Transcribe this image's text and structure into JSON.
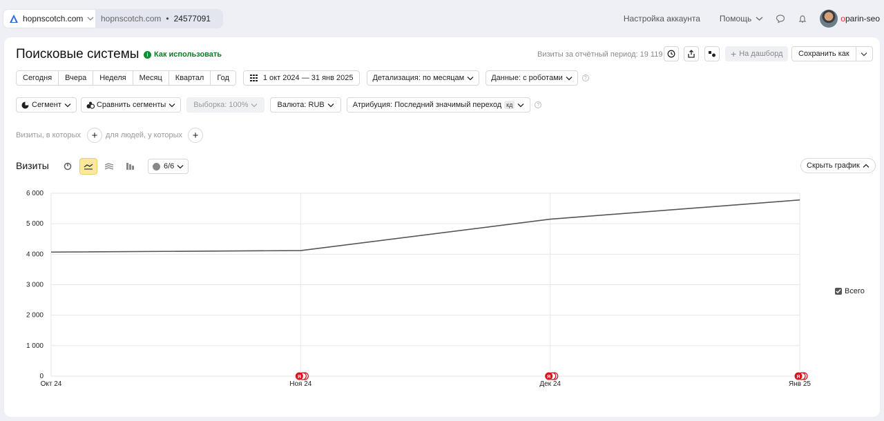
{
  "topbar": {
    "site_name": "hopnscotch.com",
    "counter_site": "hopnscotch.com",
    "counter_dot": "•",
    "counter_id": "24577091",
    "account_settings": "Настройка аккаунта",
    "help": "Помощь",
    "username_first": "o",
    "username_rest": "parin-seo"
  },
  "header": {
    "title": "Поисковые системы",
    "howto": "Как использовать",
    "visits_period": "Визиты за отчётный период: 19 119",
    "dashboard": "На дашборд",
    "save_as": "Сохранить как"
  },
  "periods": [
    "Сегодня",
    "Вчера",
    "Неделя",
    "Месяц",
    "Квартал",
    "Год"
  ],
  "date_range": "1 окт 2024 — 31 янв 2025",
  "detail": "Детализация: по месяцам",
  "data_mode": "Данные: с роботами",
  "segment": "Сегмент",
  "compare": "Сравнить сегменты",
  "sample": "Выборка: 100%",
  "currency": "Валюта: RUB",
  "attribution": "Атрибуция: Последний значимый переход",
  "attribution_badge": "кд",
  "filters": {
    "visits_label": "Визиты, в которых",
    "people_label": "для людей, у которых"
  },
  "section": {
    "title": "Визиты",
    "series_count": "6/6",
    "hide_chart": "Скрыть график"
  },
  "legend": {
    "total": "Всего"
  },
  "colors": {
    "line": "#555555",
    "event_marker": "#d9111c",
    "active_tool": "#fbe89a"
  },
  "chart_data": {
    "type": "line",
    "categories": [
      "Окт 24",
      "Ноя 24",
      "Дек 24",
      "Янв 25"
    ],
    "series": [
      {
        "name": "Всего",
        "values": [
          4070,
          4120,
          5150,
          5780
        ]
      }
    ],
    "ylim": [
      0,
      6000
    ],
    "yticks": [
      0,
      1000,
      2000,
      3000,
      4000,
      5000,
      6000
    ],
    "ytick_labels": [
      "0",
      "1 000",
      "2 000",
      "3 000",
      "4 000",
      "5 000",
      "6 000"
    ],
    "grid": true,
    "legend_position": "right",
    "event_markers": [
      {
        "category": "Ноя 24",
        "label": "Я"
      },
      {
        "category": "Дек 24",
        "label": "Я"
      },
      {
        "category": "Янв 25",
        "label": "Я"
      }
    ]
  }
}
